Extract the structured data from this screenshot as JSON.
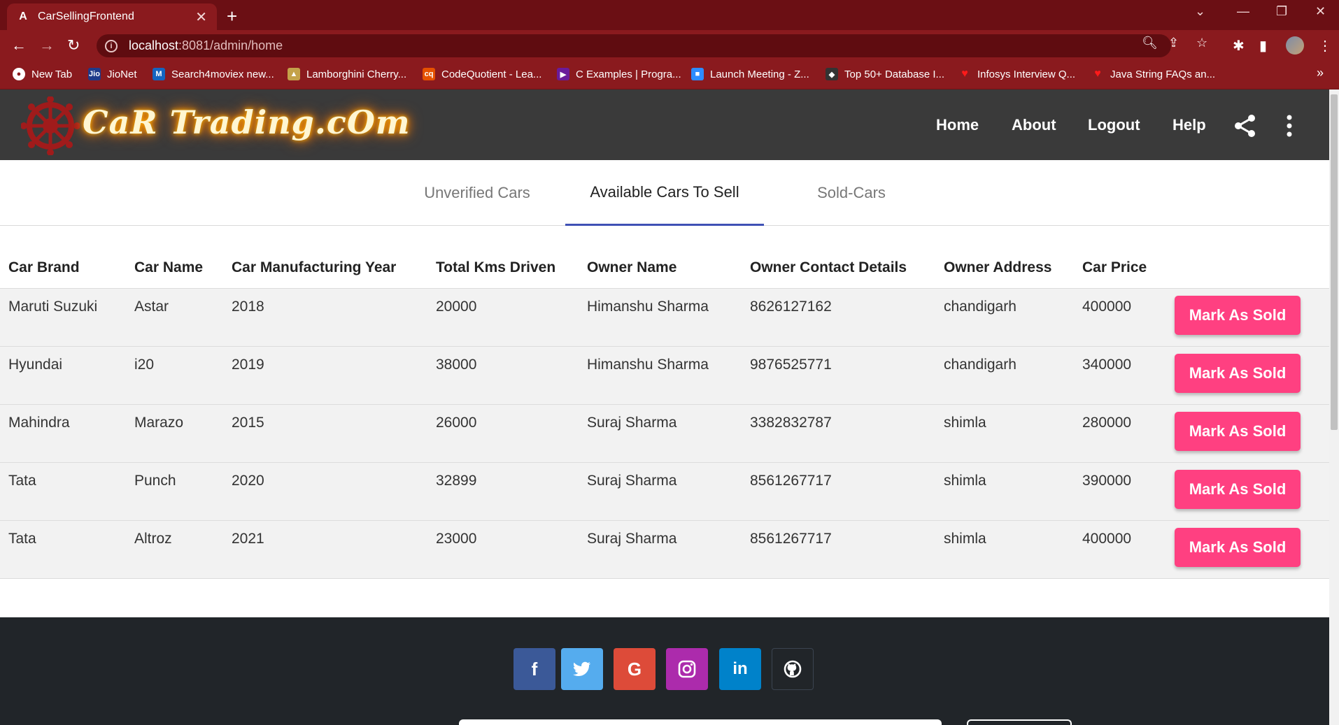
{
  "browser": {
    "tab_title": "CarSellingFrontend",
    "tab_icon": "angular-logo-icon",
    "url_host": "localhost",
    "url_path": ":8081/admin/home",
    "bookmarks": [
      {
        "label": "New Tab",
        "icon": "chrome-icon",
        "color": "#ffffff"
      },
      {
        "label": "JioNet",
        "icon": "jio-icon",
        "color": "#1e3a8a"
      },
      {
        "label": "Search4moviex new...",
        "icon": "m-icon",
        "color": "#1565c0"
      },
      {
        "label": "Lamborghini Cherry...",
        "icon": "lamborghini-icon",
        "color": "#c4a24a"
      },
      {
        "label": "CodeQuotient - Lea...",
        "icon": "cq-icon",
        "color": "#e65100"
      },
      {
        "label": "C Examples | Progra...",
        "icon": "programiz-icon",
        "color": "#6a1b9a"
      },
      {
        "label": "Launch Meeting - Z...",
        "icon": "zoom-icon",
        "color": "#2d8cff"
      },
      {
        "label": "Top 50+ Database I...",
        "icon": "db-icon",
        "color": "#333333"
      },
      {
        "label": "Infosys Interview Q...",
        "icon": "heart-icon",
        "color": "#d50000"
      },
      {
        "label": "Java String FAQs an...",
        "icon": "heart-icon",
        "color": "#d50000"
      }
    ]
  },
  "header": {
    "logo_text": "CaR Trading.cOm",
    "nav": [
      "Home",
      "About",
      "Logout",
      "Help"
    ]
  },
  "tabs": [
    "Unverified Cars",
    "Available Cars To Sell",
    "Sold-Cars"
  ],
  "active_tab": "Available Cars To Sell",
  "table": {
    "headers": [
      "Car Brand",
      "Car Name",
      "Car Manufacturing Year",
      "Total Kms Driven",
      "Owner Name",
      "Owner Contact Details",
      "Owner Address",
      "Car Price"
    ],
    "rows": [
      [
        "Maruti Suzuki",
        "Astar",
        "2018",
        "20000",
        "Himanshu Sharma",
        "8626127162",
        "chandigarh",
        "400000"
      ],
      [
        "Hyundai",
        "i20",
        "2019",
        "38000",
        "Himanshu Sharma",
        "9876525771",
        "chandigarh",
        "340000"
      ],
      [
        "Mahindra",
        "Marazo",
        "2015",
        "26000",
        "Suraj Sharma",
        "3382832787",
        "shimla",
        "280000"
      ],
      [
        "Tata",
        "Punch",
        "2020",
        "32899",
        "Suraj Sharma",
        "8561267717",
        "shimla",
        "390000"
      ],
      [
        "Tata",
        "Altroz",
        "2021",
        "23000",
        "Suraj Sharma",
        "8561267717",
        "shimla",
        "400000"
      ]
    ],
    "action_label": "Mark As Sold"
  },
  "footer": {
    "social": [
      {
        "name": "facebook-icon",
        "glyph": "f",
        "color": "#3b5998"
      },
      {
        "name": "twitter-icon",
        "glyph": "🐦",
        "color": "#55acee"
      },
      {
        "name": "google-icon",
        "glyph": "G",
        "color": "#dd4b39"
      },
      {
        "name": "instagram-icon",
        "glyph": "◎",
        "color": "#ac2bac"
      },
      {
        "name": "linkedin-icon",
        "glyph": "in",
        "color": "#0082ca"
      },
      {
        "name": "github-icon",
        "glyph": "◉",
        "color": "#333333"
      }
    ]
  },
  "colors": {
    "browser_frame": "#8a1a1e",
    "app_header": "#3a3a3a",
    "tab_indicator": "#3f51b5",
    "action_button": "#ff4081",
    "footer": "#212529"
  }
}
